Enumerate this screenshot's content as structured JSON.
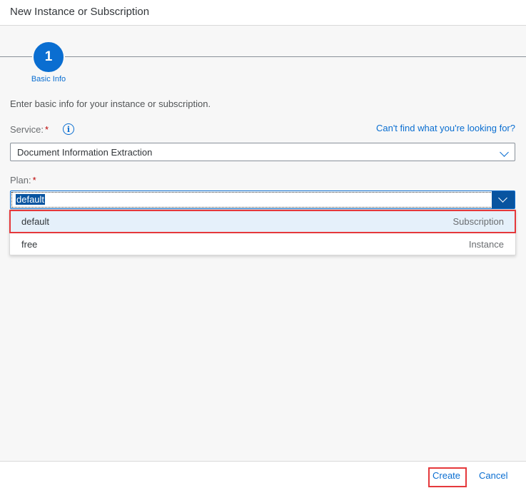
{
  "dialog": {
    "title": "New Instance or Subscription"
  },
  "wizard": {
    "step_number": "1",
    "step_label": "Basic Info"
  },
  "form": {
    "intro": "Enter basic info for your instance or subscription.",
    "service_label": "Service:",
    "required_mark": "*",
    "help_link": "Can't find what you're looking for?",
    "service_value": "Document Information Extraction",
    "plan_label": "Plan:",
    "plan_value": "default"
  },
  "plan_options": [
    {
      "name": "default",
      "type": "Subscription"
    },
    {
      "name": "free",
      "type": "Instance"
    }
  ],
  "footer": {
    "create_label": "Create",
    "cancel_label": "Cancel"
  },
  "colors": {
    "accent": "#0a6ed1",
    "highlight": "#e5383b",
    "required": "#bb0000"
  }
}
